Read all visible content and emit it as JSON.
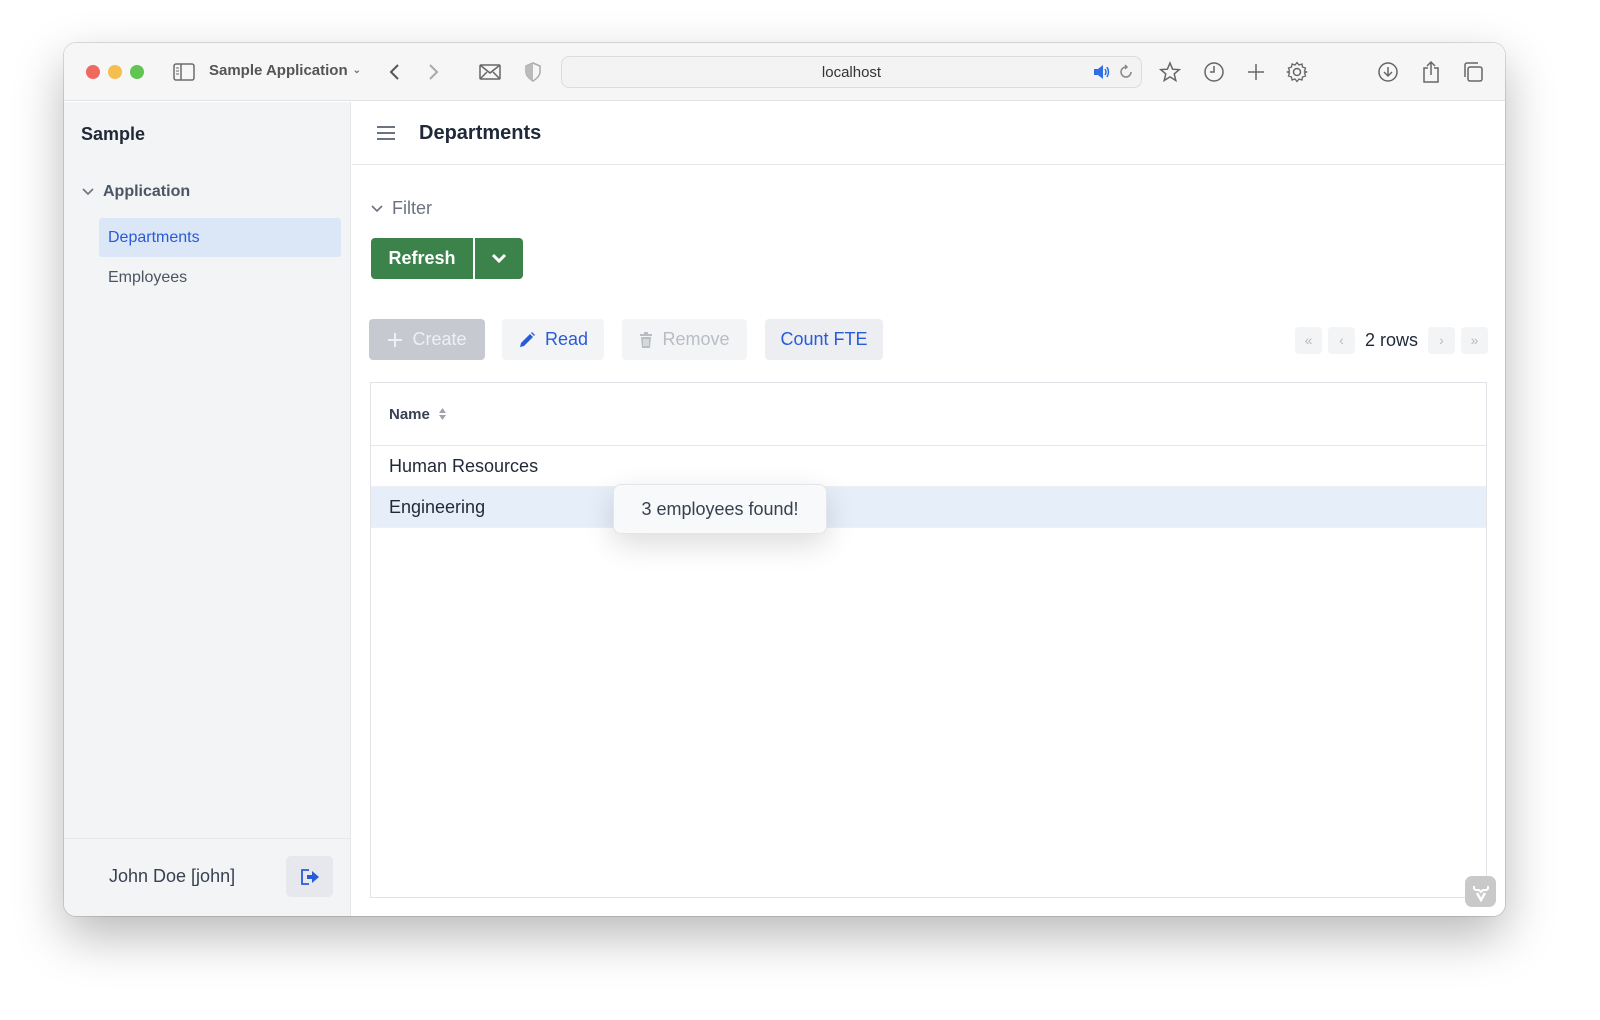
{
  "browser": {
    "app_title": "Sample Application",
    "url": "localhost",
    "icons": [
      "sidebar-toggle-icon",
      "back-icon",
      "forward-icon",
      "mail-icon",
      "shield-icon",
      "audio-icon",
      "reload-icon",
      "star-icon",
      "history-icon",
      "new-tab-icon",
      "settings-icon",
      "download-icon",
      "share-icon",
      "tabs-icon"
    ]
  },
  "sidebar": {
    "brand": "Sample",
    "group_label": "Application",
    "items": [
      {
        "label": "Departments",
        "active": true
      },
      {
        "label": "Employees",
        "active": false
      }
    ],
    "user": "John Doe [john]"
  },
  "header": {
    "title": "Departments"
  },
  "filter": {
    "label": "Filter",
    "refresh_label": "Refresh"
  },
  "toolbar": {
    "create_label": "Create",
    "read_label": "Read",
    "remove_label": "Remove",
    "count_label": "Count FTE"
  },
  "pager": {
    "label": "2 rows"
  },
  "grid": {
    "columns": [
      "Name"
    ],
    "rows": [
      {
        "name": "Human Resources",
        "selected": false
      },
      {
        "name": "Engineering",
        "selected": true
      }
    ]
  },
  "notification": {
    "text": "3 employees found!"
  },
  "colors": {
    "accent": "#2a5bd7",
    "primary_button": "#3b834b",
    "selected_row": "#e6eefa",
    "sidebar_active": "#dbe6f7"
  }
}
